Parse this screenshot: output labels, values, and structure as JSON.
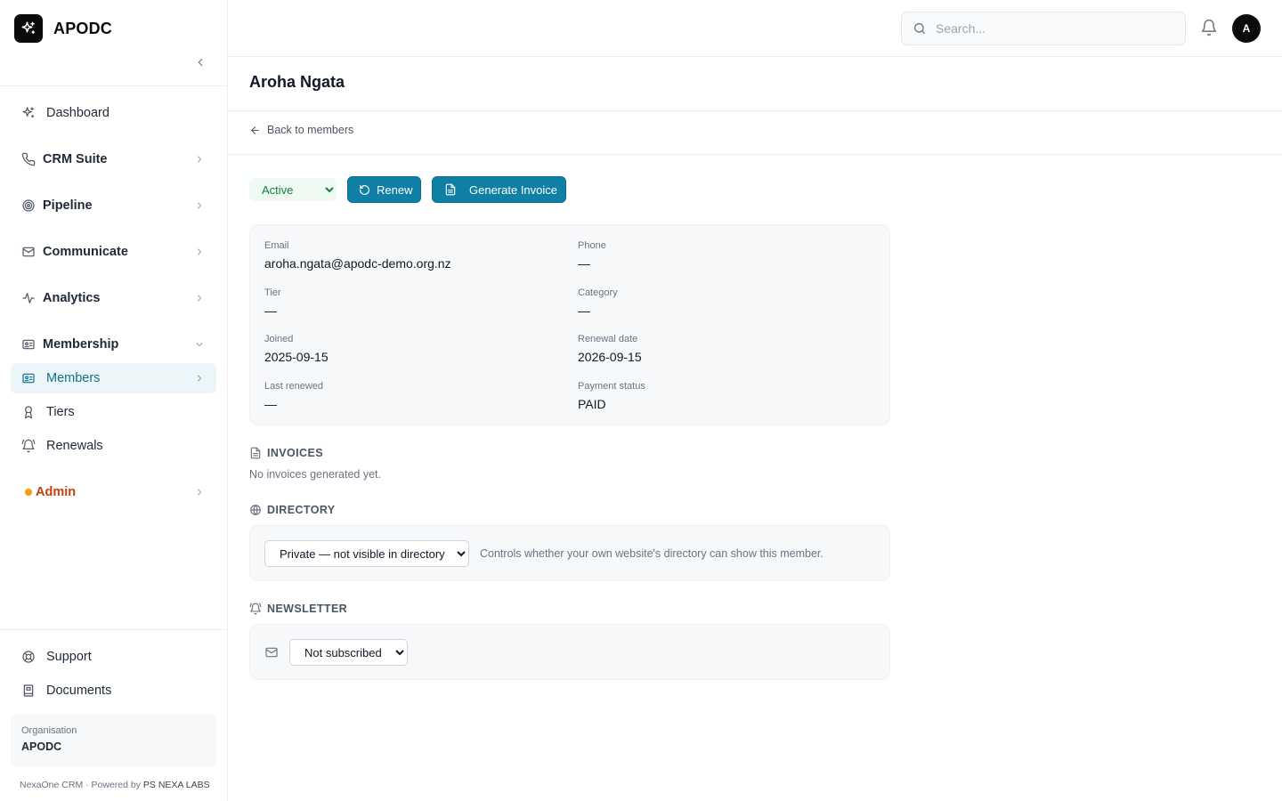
{
  "brand": {
    "name": "APODC"
  },
  "nav": {
    "dashboard": "Dashboard",
    "crm": "CRM Suite",
    "pipeline": "Pipeline",
    "communicate": "Communicate",
    "analytics": "Analytics",
    "membership": "Membership",
    "members": "Members",
    "tiers": "Tiers",
    "renewals": "Renewals",
    "admin": "Admin",
    "support": "Support",
    "documents": "Documents"
  },
  "organisation": {
    "label": "Organisation",
    "name": "APODC"
  },
  "footer": {
    "product": "NexaOne CRM",
    "powered_prefix": "· Powered by",
    "vendor": "PS NEXA LABS"
  },
  "topbar": {
    "search_placeholder": "Search...",
    "avatar_initial": "A"
  },
  "page": {
    "title": "Aroha Ngata",
    "back_label": "Back to members"
  },
  "actions": {
    "status_options": [
      "Active"
    ],
    "status_selected": "Active",
    "renew_label": "Renew",
    "invoice_label": "Generate Invoice"
  },
  "member": {
    "email_label": "Email",
    "email": "aroha.ngata@apodc-demo.org.nz",
    "phone_label": "Phone",
    "phone": "—",
    "tier_label": "Tier",
    "tier": "—",
    "category_label": "Category",
    "category": "—",
    "joined_label": "Joined",
    "joined": "2025-09-15",
    "renewal_label": "Renewal date",
    "renewal": "2026-09-15",
    "last_renewed_label": "Last renewed",
    "last_renewed": "—",
    "payment_label": "Payment status",
    "payment": "PAID"
  },
  "invoices": {
    "heading": "INVOICES",
    "empty": "No invoices generated yet."
  },
  "directory": {
    "heading": "DIRECTORY",
    "selected": "Private — not visible in directory",
    "note": "Controls whether your own website's directory can show this member."
  },
  "newsletter": {
    "heading": "NEWSLETTER",
    "selected": "Not subscribed"
  }
}
